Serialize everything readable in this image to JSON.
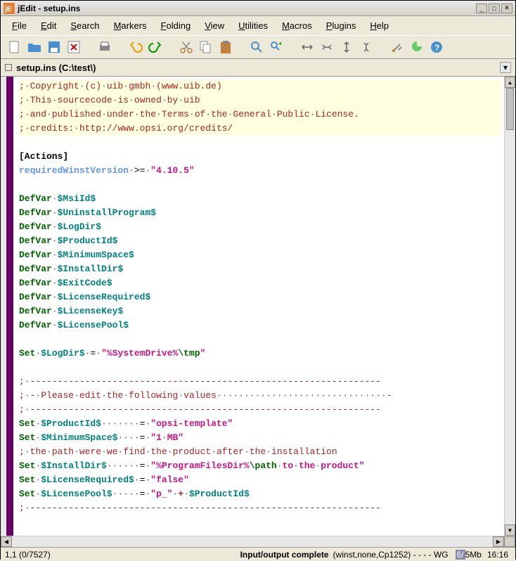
{
  "window": {
    "app_icon_text": "jE",
    "title": "jEdit - setup.ins"
  },
  "menus": [
    "File",
    "Edit",
    "Search",
    "Markers",
    "Folding",
    "View",
    "Utilities",
    "Macros",
    "Plugins",
    "Help"
  ],
  "buffer": {
    "name": "setup.ins (C:\\test\\)"
  },
  "code_lines": [
    {
      "type": "comment",
      "hl": true,
      "tokens": [
        {
          "t": "c-comment",
          "v": ";"
        },
        {
          "t": "c-dot",
          "v": "·"
        },
        {
          "t": "c-comment",
          "v": "Copyright"
        },
        {
          "t": "c-dot",
          "v": "·"
        },
        {
          "t": "c-comment",
          "v": "(c)"
        },
        {
          "t": "c-dot",
          "v": "·"
        },
        {
          "t": "c-comment",
          "v": "uib"
        },
        {
          "t": "c-dot",
          "v": "·"
        },
        {
          "t": "c-comment",
          "v": "gmbh"
        },
        {
          "t": "c-dot",
          "v": "·"
        },
        {
          "t": "c-comment",
          "v": "(www.uib.de)"
        }
      ]
    },
    {
      "type": "comment",
      "hl": true,
      "tokens": [
        {
          "t": "c-comment",
          "v": ";"
        },
        {
          "t": "c-dot",
          "v": "·"
        },
        {
          "t": "c-comment",
          "v": "This"
        },
        {
          "t": "c-dot",
          "v": "·"
        },
        {
          "t": "c-comment",
          "v": "sourcecode"
        },
        {
          "t": "c-dot",
          "v": "·"
        },
        {
          "t": "c-comment",
          "v": "is"
        },
        {
          "t": "c-dot",
          "v": "·"
        },
        {
          "t": "c-comment",
          "v": "owned"
        },
        {
          "t": "c-dot",
          "v": "·"
        },
        {
          "t": "c-comment",
          "v": "by"
        },
        {
          "t": "c-dot",
          "v": "·"
        },
        {
          "t": "c-comment",
          "v": "uib"
        }
      ]
    },
    {
      "type": "comment",
      "hl": true,
      "tokens": [
        {
          "t": "c-comment",
          "v": ";"
        },
        {
          "t": "c-dot",
          "v": "·"
        },
        {
          "t": "c-comment",
          "v": "and"
        },
        {
          "t": "c-dot",
          "v": "·"
        },
        {
          "t": "c-comment",
          "v": "published"
        },
        {
          "t": "c-dot",
          "v": "·"
        },
        {
          "t": "c-comment",
          "v": "under"
        },
        {
          "t": "c-dot",
          "v": "·"
        },
        {
          "t": "c-comment",
          "v": "the"
        },
        {
          "t": "c-dot",
          "v": "·"
        },
        {
          "t": "c-comment",
          "v": "Terms"
        },
        {
          "t": "c-dot",
          "v": "·"
        },
        {
          "t": "c-comment",
          "v": "of"
        },
        {
          "t": "c-dot",
          "v": "·"
        },
        {
          "t": "c-comment",
          "v": "the"
        },
        {
          "t": "c-dot",
          "v": "·"
        },
        {
          "t": "c-comment",
          "v": "General"
        },
        {
          "t": "c-dot",
          "v": "·"
        },
        {
          "t": "c-comment",
          "v": "Public"
        },
        {
          "t": "c-dot",
          "v": "·"
        },
        {
          "t": "c-comment",
          "v": "License."
        }
      ]
    },
    {
      "type": "comment",
      "hl": true,
      "tokens": [
        {
          "t": "c-comment",
          "v": ";"
        },
        {
          "t": "c-dot",
          "v": "·"
        },
        {
          "t": "c-comment",
          "v": "credits:"
        },
        {
          "t": "c-dot",
          "v": "·"
        },
        {
          "t": "c-comment",
          "v": "http://www.opsi.org/credits/"
        }
      ]
    },
    {
      "type": "blank",
      "tokens": []
    },
    {
      "type": "section",
      "tokens": [
        {
          "t": "c-section",
          "v": "[Actions]"
        }
      ]
    },
    {
      "type": "line",
      "tokens": [
        {
          "t": "c-key",
          "v": "requiredWinstVersion"
        },
        {
          "t": "c-dot",
          "v": "·"
        },
        {
          "t": "c-op",
          "v": ">="
        },
        {
          "t": "c-dot",
          "v": "·"
        },
        {
          "t": "c-str",
          "v": "\"4.10.5\""
        }
      ]
    },
    {
      "type": "blank",
      "tokens": []
    },
    {
      "type": "line",
      "tokens": [
        {
          "t": "c-keyword",
          "v": "DefVar"
        },
        {
          "t": "c-dot",
          "v": "·"
        },
        {
          "t": "c-var",
          "v": "$MsiId$"
        }
      ]
    },
    {
      "type": "line",
      "tokens": [
        {
          "t": "c-keyword",
          "v": "DefVar"
        },
        {
          "t": "c-dot",
          "v": "·"
        },
        {
          "t": "c-var",
          "v": "$UninstallProgram$"
        }
      ]
    },
    {
      "type": "line",
      "tokens": [
        {
          "t": "c-keyword",
          "v": "DefVar"
        },
        {
          "t": "c-dot",
          "v": "·"
        },
        {
          "t": "c-var",
          "v": "$LogDir$"
        }
      ]
    },
    {
      "type": "line",
      "tokens": [
        {
          "t": "c-keyword",
          "v": "DefVar"
        },
        {
          "t": "c-dot",
          "v": "·"
        },
        {
          "t": "c-var",
          "v": "$ProductId$"
        }
      ]
    },
    {
      "type": "line",
      "tokens": [
        {
          "t": "c-keyword",
          "v": "DefVar"
        },
        {
          "t": "c-dot",
          "v": "·"
        },
        {
          "t": "c-var",
          "v": "$MinimumSpace$"
        }
      ]
    },
    {
      "type": "line",
      "tokens": [
        {
          "t": "c-keyword",
          "v": "DefVar"
        },
        {
          "t": "c-dot",
          "v": "·"
        },
        {
          "t": "c-var",
          "v": "$InstallDir$"
        }
      ]
    },
    {
      "type": "line",
      "tokens": [
        {
          "t": "c-keyword",
          "v": "DefVar"
        },
        {
          "t": "c-dot",
          "v": "·"
        },
        {
          "t": "c-var",
          "v": "$ExitCode$"
        }
      ]
    },
    {
      "type": "line",
      "tokens": [
        {
          "t": "c-keyword",
          "v": "DefVar"
        },
        {
          "t": "c-dot",
          "v": "·"
        },
        {
          "t": "c-var",
          "v": "$LicenseRequired$"
        }
      ]
    },
    {
      "type": "line",
      "tokens": [
        {
          "t": "c-keyword",
          "v": "DefVar"
        },
        {
          "t": "c-dot",
          "v": "·"
        },
        {
          "t": "c-var",
          "v": "$LicenseKey$"
        }
      ]
    },
    {
      "type": "line",
      "tokens": [
        {
          "t": "c-keyword",
          "v": "DefVar"
        },
        {
          "t": "c-dot",
          "v": "·"
        },
        {
          "t": "c-var",
          "v": "$LicensePool$"
        }
      ]
    },
    {
      "type": "blank",
      "tokens": []
    },
    {
      "type": "line",
      "tokens": [
        {
          "t": "c-keyword",
          "v": "Set"
        },
        {
          "t": "c-dot",
          "v": "·"
        },
        {
          "t": "c-var",
          "v": "$LogDir$"
        },
        {
          "t": "c-dot",
          "v": "·"
        },
        {
          "t": "c-op",
          "v": "="
        },
        {
          "t": "c-dot",
          "v": "·"
        },
        {
          "t": "c-str",
          "v": "\""
        },
        {
          "t": "c-builtin",
          "v": "%SystemDrive%"
        },
        {
          "t": "c-escape",
          "v": "\\tmp"
        },
        {
          "t": "c-str",
          "v": "\""
        }
      ]
    },
    {
      "type": "blank",
      "tokens": []
    },
    {
      "type": "line",
      "tokens": [
        {
          "t": "c-comment",
          "v": ";"
        },
        {
          "t": "c-dot",
          "v": "·"
        },
        {
          "t": "c-dash",
          "v": "----------------------------------------------------------------"
        }
      ]
    },
    {
      "type": "line",
      "tokens": [
        {
          "t": "c-comment",
          "v": ";"
        },
        {
          "t": "c-dot",
          "v": "·"
        },
        {
          "t": "c-comment",
          "v": "-"
        },
        {
          "t": "c-dot",
          "v": "·"
        },
        {
          "t": "c-comment",
          "v": "Please"
        },
        {
          "t": "c-dot",
          "v": "·"
        },
        {
          "t": "c-comment",
          "v": "edit"
        },
        {
          "t": "c-dot",
          "v": "·"
        },
        {
          "t": "c-comment",
          "v": "the"
        },
        {
          "t": "c-dot",
          "v": "·"
        },
        {
          "t": "c-comment",
          "v": "following"
        },
        {
          "t": "c-dot",
          "v": "·"
        },
        {
          "t": "c-comment",
          "v": "values"
        },
        {
          "t": "c-dot",
          "v": "·······························"
        },
        {
          "t": "c-comment",
          "v": "-"
        }
      ]
    },
    {
      "type": "line",
      "tokens": [
        {
          "t": "c-comment",
          "v": ";"
        },
        {
          "t": "c-dot",
          "v": "·"
        },
        {
          "t": "c-dash",
          "v": "----------------------------------------------------------------"
        }
      ]
    },
    {
      "type": "line",
      "tokens": [
        {
          "t": "c-keyword",
          "v": "Set"
        },
        {
          "t": "c-dot",
          "v": "·"
        },
        {
          "t": "c-var",
          "v": "$ProductId$"
        },
        {
          "t": "c-dot",
          "v": "·······"
        },
        {
          "t": "c-op",
          "v": "="
        },
        {
          "t": "c-dot",
          "v": "·"
        },
        {
          "t": "c-str",
          "v": "\"opsi-template\""
        }
      ]
    },
    {
      "type": "line",
      "tokens": [
        {
          "t": "c-keyword",
          "v": "Set"
        },
        {
          "t": "c-dot",
          "v": "·"
        },
        {
          "t": "c-var",
          "v": "$MinimumSpace$"
        },
        {
          "t": "c-dot",
          "v": "····"
        },
        {
          "t": "c-op",
          "v": "="
        },
        {
          "t": "c-dot",
          "v": "·"
        },
        {
          "t": "c-str",
          "v": "\"1"
        },
        {
          "t": "c-dot",
          "v": "·"
        },
        {
          "t": "c-str",
          "v": "MB\""
        }
      ]
    },
    {
      "type": "line",
      "tokens": [
        {
          "t": "c-comment",
          "v": ";"
        },
        {
          "t": "c-dot",
          "v": "·"
        },
        {
          "t": "c-comment",
          "v": "the"
        },
        {
          "t": "c-dot",
          "v": "·"
        },
        {
          "t": "c-comment",
          "v": "path"
        },
        {
          "t": "c-dot",
          "v": "·"
        },
        {
          "t": "c-comment",
          "v": "were"
        },
        {
          "t": "c-dot",
          "v": "·"
        },
        {
          "t": "c-comment",
          "v": "we"
        },
        {
          "t": "c-dot",
          "v": "·"
        },
        {
          "t": "c-comment",
          "v": "find"
        },
        {
          "t": "c-dot",
          "v": "·"
        },
        {
          "t": "c-comment",
          "v": "the"
        },
        {
          "t": "c-dot",
          "v": "·"
        },
        {
          "t": "c-comment",
          "v": "product"
        },
        {
          "t": "c-dot",
          "v": "·"
        },
        {
          "t": "c-comment",
          "v": "after"
        },
        {
          "t": "c-dot",
          "v": "·"
        },
        {
          "t": "c-comment",
          "v": "the"
        },
        {
          "t": "c-dot",
          "v": "·"
        },
        {
          "t": "c-comment",
          "v": "installation"
        }
      ]
    },
    {
      "type": "line",
      "tokens": [
        {
          "t": "c-keyword",
          "v": "Set"
        },
        {
          "t": "c-dot",
          "v": "·"
        },
        {
          "t": "c-var",
          "v": "$InstallDir$"
        },
        {
          "t": "c-dot",
          "v": "······"
        },
        {
          "t": "c-op",
          "v": "="
        },
        {
          "t": "c-dot",
          "v": "·"
        },
        {
          "t": "c-str",
          "v": "\""
        },
        {
          "t": "c-builtin",
          "v": "%ProgramFilesDir%"
        },
        {
          "t": "c-escape",
          "v": "\\path"
        },
        {
          "t": "c-dot",
          "v": "·"
        },
        {
          "t": "c-str",
          "v": "to"
        },
        {
          "t": "c-dot",
          "v": "·"
        },
        {
          "t": "c-str",
          "v": "the"
        },
        {
          "t": "c-dot",
          "v": "·"
        },
        {
          "t": "c-str",
          "v": "product\""
        }
      ]
    },
    {
      "type": "line",
      "tokens": [
        {
          "t": "c-keyword",
          "v": "Set"
        },
        {
          "t": "c-dot",
          "v": "·"
        },
        {
          "t": "c-var",
          "v": "$LicenseRequired$"
        },
        {
          "t": "c-dot",
          "v": "·"
        },
        {
          "t": "c-op",
          "v": "="
        },
        {
          "t": "c-dot",
          "v": "·"
        },
        {
          "t": "c-str",
          "v": "\"false\""
        }
      ]
    },
    {
      "type": "line",
      "tokens": [
        {
          "t": "c-keyword",
          "v": "Set"
        },
        {
          "t": "c-dot",
          "v": "·"
        },
        {
          "t": "c-var",
          "v": "$LicensePool$"
        },
        {
          "t": "c-dot",
          "v": "·····"
        },
        {
          "t": "c-op",
          "v": "="
        },
        {
          "t": "c-dot",
          "v": "·"
        },
        {
          "t": "c-str",
          "v": "\"p_\""
        },
        {
          "t": "c-dot",
          "v": "·"
        },
        {
          "t": "c-plus",
          "v": "+"
        },
        {
          "t": "c-dot",
          "v": "·"
        },
        {
          "t": "c-var",
          "v": "$ProductId$"
        }
      ]
    },
    {
      "type": "line",
      "tokens": [
        {
          "t": "c-comment",
          "v": ";"
        },
        {
          "t": "c-dot",
          "v": "·"
        },
        {
          "t": "c-dash",
          "v": "----------------------------------------------------------------"
        }
      ]
    }
  ],
  "status": {
    "position": "1,1 (0/7527)",
    "message": "Input/output complete",
    "mode": "(winst,none,Cp1252) -  -  -  - WG",
    "mem_used": "6/",
    "mem_total": "5Mb",
    "time": "16:16"
  },
  "toolbar_icons": [
    "new-file",
    "open-file",
    "save-file",
    "close-file",
    "sep",
    "print",
    "sep",
    "undo",
    "redo",
    "sep",
    "cut",
    "copy",
    "paste",
    "sep",
    "search",
    "search-replace",
    "sep",
    "expand-h",
    "shrink-h",
    "expand-v",
    "shrink-v",
    "sep",
    "settings",
    "plugin",
    "help"
  ]
}
